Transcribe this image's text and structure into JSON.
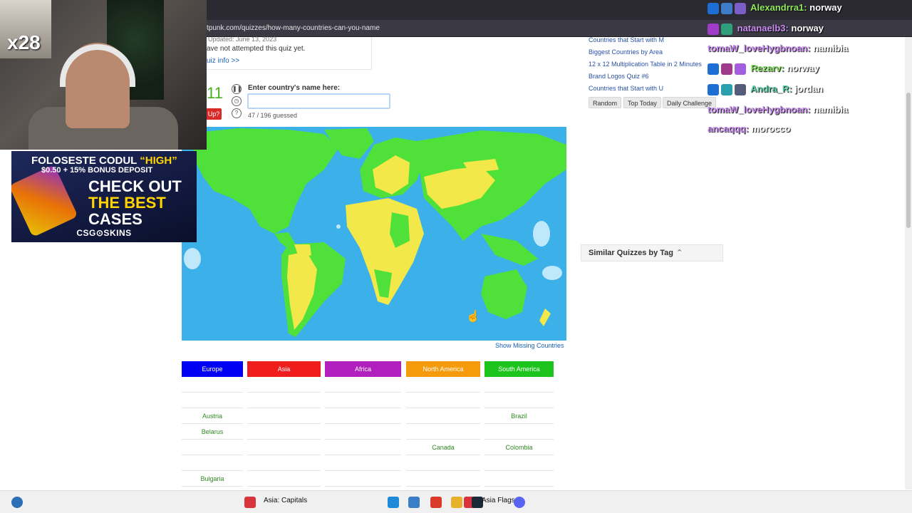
{
  "browser": {
    "url": "tpunk.com/quizzes/how-many-countries-can-you-name"
  },
  "overlay": {
    "multiplier": "x28",
    "ad": {
      "line1_white": "FOLOSESTE CODUL ",
      "line1_yellow": "“HIGH”",
      "line2": "$0.50 + 15% BONUS DEPOSIT",
      "line3": "CHECK OUT",
      "line4": "THE BEST",
      "line5": "CASES",
      "brand": "CSG⊙SKINS"
    }
  },
  "quiz": {
    "updated_text": "Updated: June 13, 2023",
    "attempt_text": "ave not attempted this quiz yet.",
    "info_link": "uiz info >>",
    "timer": "11",
    "give_up_label": "Up?",
    "enter_label": "Enter country's name here:",
    "input_value": "",
    "guessed_text": "47 / 196 guessed",
    "show_missing": "Show Missing Countries",
    "pause_icon": "pause-icon",
    "clock_icon": "clock-icon",
    "help_icon": "help-icon"
  },
  "continents": [
    {
      "name": "Europe",
      "color": "#0000f5",
      "cells": [
        "",
        "",
        "Austria",
        "Belarus",
        "",
        "",
        "Bulgaria"
      ]
    },
    {
      "name": "Asia",
      "color": "#f01d1d",
      "cells": [
        "",
        "",
        "",
        "",
        "",
        "",
        ""
      ]
    },
    {
      "name": "Africa",
      "color": "#b21fbf",
      "cells": [
        "",
        "",
        "",
        "",
        "",
        "",
        ""
      ]
    },
    {
      "name": "North America",
      "color": "#f59a0a",
      "cells": [
        "",
        "",
        "",
        "",
        "Canada",
        "",
        ""
      ]
    },
    {
      "name": "South America",
      "color": "#1ec41e",
      "cells": [
        "",
        "",
        "Brazil",
        "",
        "Colombia",
        "",
        ""
      ]
    }
  ],
  "sidebar": {
    "links": [
      "Countries that Start with M",
      "Biggest Countries by Area",
      "12 x 12 Multiplication Table in 2 Minutes",
      "Brand Logos Quiz #6",
      "Countries that Start with U"
    ],
    "buttons": [
      "Random",
      "Top Today",
      "Daily Challenge"
    ],
    "similar_title": "Similar Quizzes by Tag"
  },
  "chat": [
    {
      "user": "Alexandrra1:",
      "msg": "norway",
      "color": "#8ee85c"
    },
    {
      "user": "natanaelb3:",
      "msg": "norway",
      "color": "#c98cf0"
    },
    {
      "user": "tomaW_loveHygbnoan:",
      "msg": "namibia",
      "color": "#c98cf0"
    },
    {
      "user": "Rezarv:",
      "msg": "norway",
      "color": "#7ee05c"
    },
    {
      "user": "Andra_R:",
      "msg": "jordan",
      "color": "#5ad0a8"
    },
    {
      "user": "tomaW_loveHygbnoan:",
      "msg": "namibia",
      "color": "#c98cf0"
    },
    {
      "user": "ancaqqq:",
      "msg": "morocco",
      "color": "#c98cf0"
    }
  ],
  "taskbar": {
    "item1": "Asia: Capitals",
    "item2": "Asia Flags"
  },
  "colors": {
    "map_ocean": "#3cb0e8",
    "map_land": "#4fe03a",
    "map_guessed": "#f2e84a"
  }
}
